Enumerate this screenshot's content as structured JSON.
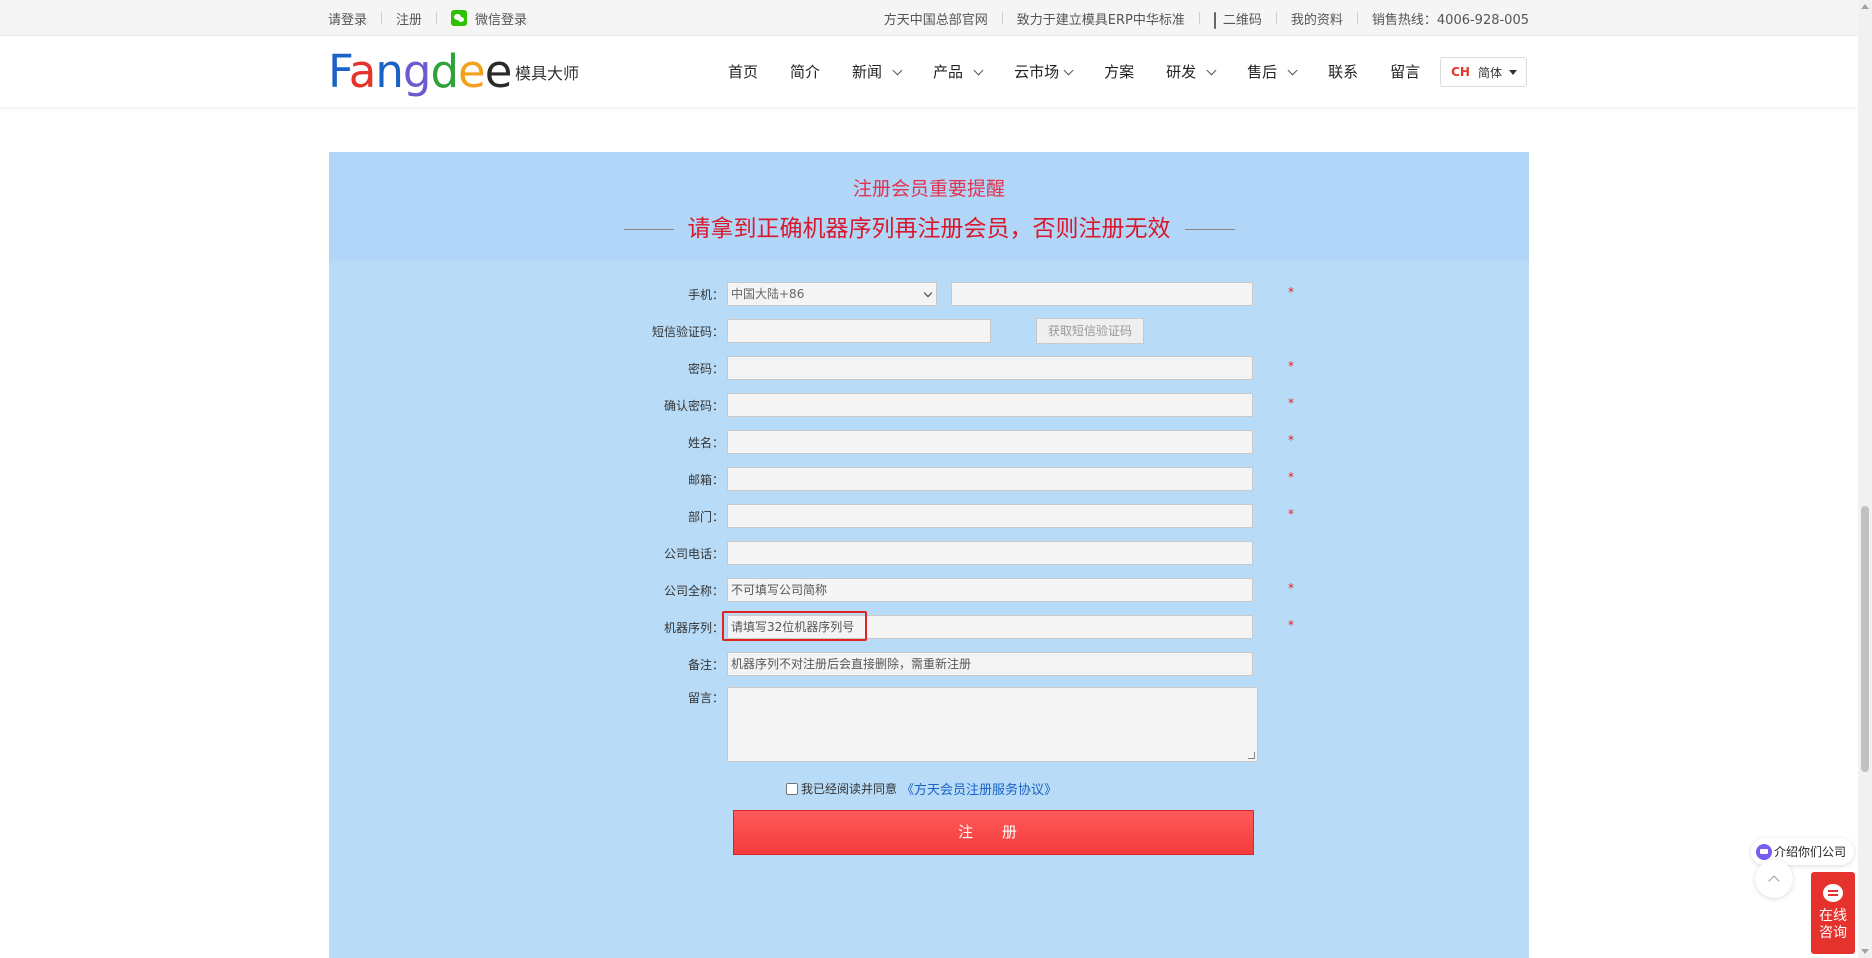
{
  "topbar": {
    "login": "请登录",
    "register": "注册",
    "wechat_login": "微信登录",
    "official_site": "方天中国总部官网",
    "slogan": "致力于建立模具ERP中华标准",
    "qrcode": "二维码",
    "my_profile": "我的资料",
    "hotline": "销售热线：4006-928-005"
  },
  "header": {
    "logo_text": [
      "F",
      "a",
      "n",
      "g",
      "d",
      "e",
      "e"
    ],
    "logo_sub": "模具大师",
    "nav": [
      {
        "label": "首页",
        "has_dropdown": false
      },
      {
        "label": "简介",
        "has_dropdown": false
      },
      {
        "label": "新闻",
        "has_dropdown": true
      },
      {
        "label": "产品",
        "has_dropdown": true
      },
      {
        "label": "云市场",
        "has_dropdown": true
      },
      {
        "label": "方案",
        "has_dropdown": false
      },
      {
        "label": "研发",
        "has_dropdown": true
      },
      {
        "label": "售后",
        "has_dropdown": true
      },
      {
        "label": "联系",
        "has_dropdown": false
      },
      {
        "label": "留言",
        "has_dropdown": false
      }
    ],
    "lang_flag": "CH",
    "lang_label": "简体"
  },
  "notice": {
    "title": "注册会员重要提醒",
    "main": "请拿到正确机器序列再注册会员，否则注册无效"
  },
  "form": {
    "phone_label": "手机：",
    "phone_country": "中国大陆+86",
    "phone_value": "",
    "sms_label": "短信验证码：",
    "sms_button": "获取短信验证码",
    "password_label": "密码：",
    "confirm_password_label": "确认密码：",
    "name_label": "姓名：",
    "email_label": "邮箱：",
    "department_label": "部门：",
    "company_phone_label": "公司电话：",
    "company_name_label": "公司全称：",
    "company_name_placeholder": "不可填写公司简称",
    "serial_label": "机器序列：",
    "serial_placeholder": "请填写32位机器序列号",
    "remark_label": "备注：",
    "remark_value": "机器序列不对注册后会直接删除，需重新注册",
    "message_label": "留言：",
    "required_mark": "*",
    "agree_text": "我已经阅读并同意",
    "agree_link": "《方天会员注册服务协议》",
    "submit": "注 册"
  },
  "widgets": {
    "intro": "介绍你们公司",
    "online_line1": "在线",
    "online_line2": "咨询"
  },
  "colors": {
    "panel_bg": "#b8dcf8",
    "accent_red": "#d9182c",
    "submit_red": "#f53b3b",
    "link_blue": "#1a62c6"
  }
}
